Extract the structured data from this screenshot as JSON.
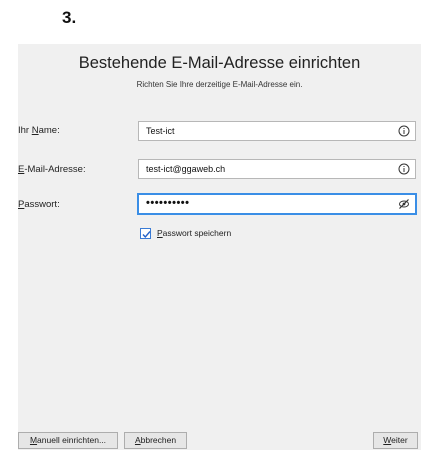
{
  "step_label": "3.",
  "dialog": {
    "title": "Bestehende E-Mail-Adresse einrichten",
    "subtitle": "Richten Sie Ihre derzeitige E-Mail-Adresse ein."
  },
  "fields": {
    "name": {
      "label_pre": "Ihr ",
      "label_acc": "N",
      "label_post": "ame:",
      "value": "Test-ict",
      "icon": "info-icon"
    },
    "email": {
      "label_pre": "",
      "label_acc": "E",
      "label_post": "-Mail-Adresse:",
      "value": "test-ict@ggaweb.ch",
      "icon": "info-icon"
    },
    "password": {
      "label_pre": "",
      "label_acc": "P",
      "label_post": "asswort:",
      "value": "••••••••••",
      "icon": "eye-slash-icon"
    }
  },
  "remember_password": {
    "checked": true,
    "label_acc": "P",
    "label_post": "asswort speichern"
  },
  "buttons": {
    "manual": {
      "acc": "M",
      "rest": "anuell einrichten..."
    },
    "cancel": {
      "acc": "A",
      "rest": "bbrechen"
    },
    "next": {
      "acc": "W",
      "rest": "eiter"
    }
  },
  "colors": {
    "dialog_bg": "#f0f0f0",
    "focus_accent": "#3a8ee6"
  }
}
